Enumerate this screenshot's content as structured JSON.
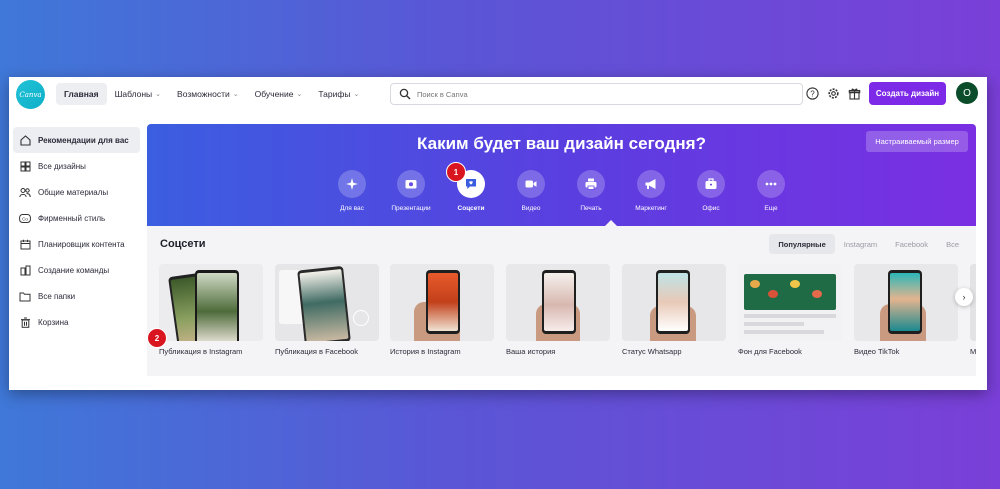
{
  "app": {
    "logo_text": "Canva",
    "brand_color": "#7d2ae8"
  },
  "nav": {
    "items": [
      {
        "label": "Главная",
        "dropdown": false
      },
      {
        "label": "Шаблоны",
        "dropdown": true
      },
      {
        "label": "Возможности",
        "dropdown": true
      },
      {
        "label": "Обучение",
        "dropdown": true
      },
      {
        "label": "Тарифы",
        "dropdown": true
      }
    ]
  },
  "search": {
    "placeholder": "Поиск в Canva"
  },
  "header": {
    "create_label": "Создать дизайн",
    "avatar_initial": "О"
  },
  "sidebar": {
    "items": [
      {
        "label": "Рекомендации для вас",
        "icon": "home-icon"
      },
      {
        "label": "Все дизайны",
        "icon": "grid-icon"
      },
      {
        "label": "Общие материалы",
        "icon": "people-icon"
      },
      {
        "label": "Фирменный стиль",
        "icon": "brand-kit-icon"
      },
      {
        "label": "Планировщик контента",
        "icon": "calendar-icon"
      },
      {
        "label": "Создание команды",
        "icon": "team-icon"
      },
      {
        "label": "Все папки",
        "icon": "folder-icon"
      },
      {
        "label": "Корзина",
        "icon": "trash-icon"
      }
    ]
  },
  "banner": {
    "title": "Каким будет ваш дизайн сегодня?",
    "custom_size_label": "Настраиваемый размер",
    "categories": [
      {
        "label": "Для вас",
        "icon": "sparkle-icon"
      },
      {
        "label": "Презентации",
        "icon": "presentation-icon"
      },
      {
        "label": "Соцсети",
        "icon": "social-icon"
      },
      {
        "label": "Видео",
        "icon": "video-icon"
      },
      {
        "label": "Печать",
        "icon": "print-icon"
      },
      {
        "label": "Маркетинг",
        "icon": "megaphone-icon"
      },
      {
        "label": "Офис",
        "icon": "briefcase-icon"
      },
      {
        "label": "Еще",
        "icon": "more-icon"
      }
    ]
  },
  "annotations": {
    "badge_1": "1",
    "badge_2": "2",
    "badge_color": "#d9151f"
  },
  "section": {
    "title": "Соцсети",
    "filters": [
      "Популярные",
      "Instagram",
      "Facebook",
      "Все"
    ],
    "cards": [
      {
        "label": "Публикация в Instagram"
      },
      {
        "label": "Публикация в Facebook"
      },
      {
        "label": "История в Instagram"
      },
      {
        "label": "Ваша история"
      },
      {
        "label": "Статус Whatsapp"
      },
      {
        "label": "Фон для Facebook"
      },
      {
        "label": "Видео TikTok"
      },
      {
        "label": "М"
      }
    ]
  }
}
